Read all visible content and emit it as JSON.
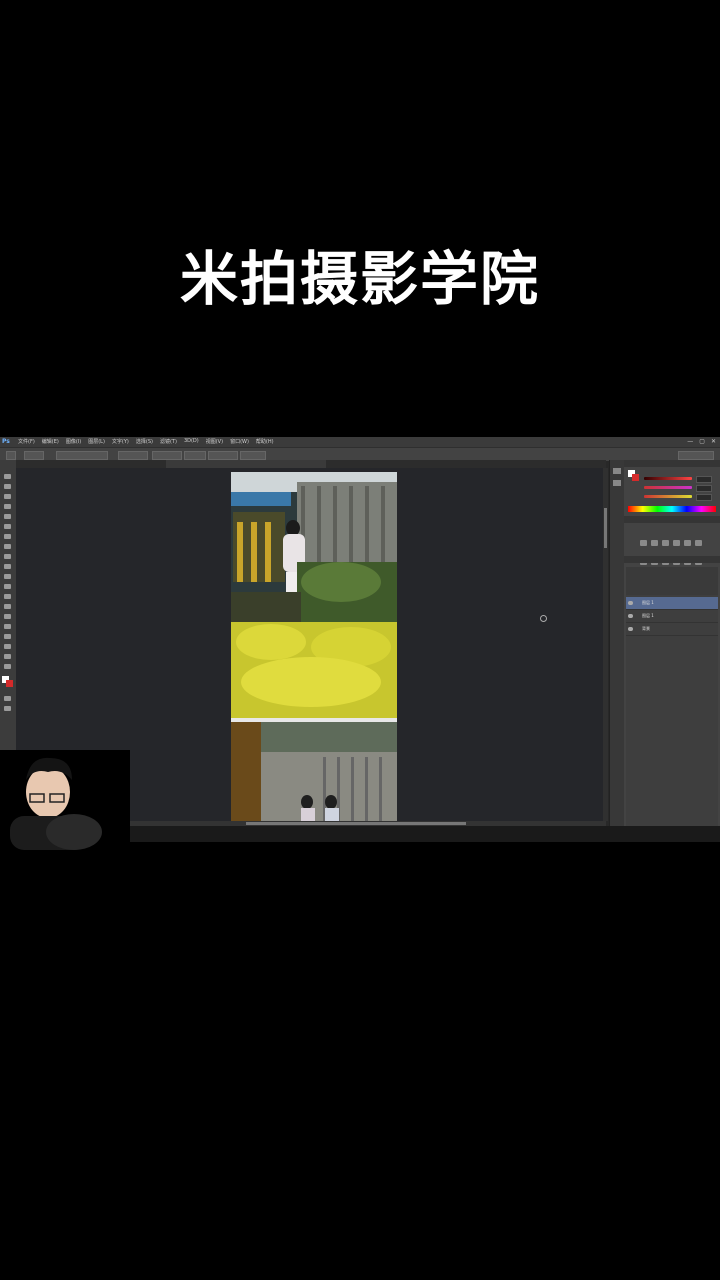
{
  "title": "米拍摄影学院",
  "photoshop": {
    "logo": "Ps",
    "menu": [
      "文件(F)",
      "编辑(E)",
      "图像(I)",
      "图层(L)",
      "文字(Y)",
      "选择(S)",
      "滤镜(T)",
      "3D(D)",
      "视图(V)",
      "窗口(W)",
      "帮助(H)"
    ],
    "window_buttons": [
      "—",
      "▢",
      "✕"
    ],
    "layers": [
      {
        "name": "图层 1",
        "selected": true
      },
      {
        "name": "图层 1",
        "selected": false
      },
      {
        "name": "背景",
        "selected": false
      }
    ]
  },
  "colors": {
    "accent": "#566a91",
    "background": "#000000",
    "canvas": "#25262a"
  }
}
